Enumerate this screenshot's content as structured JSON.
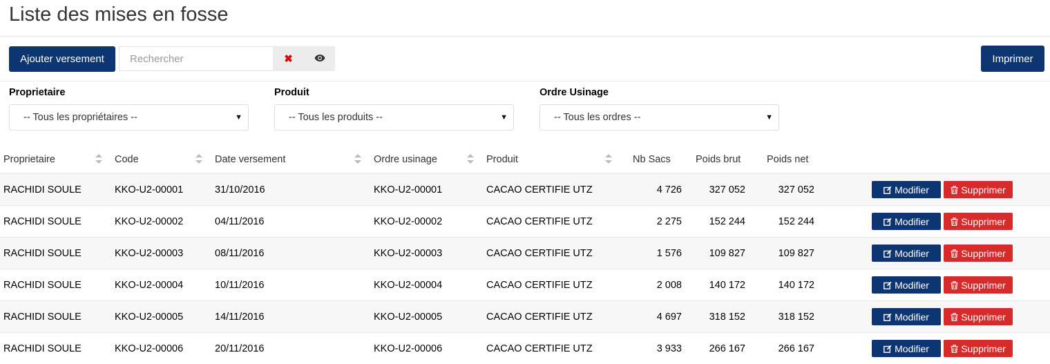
{
  "page": {
    "title": "Liste des mises en fosse"
  },
  "toolbar": {
    "add_label": "Ajouter versement",
    "search_placeholder": "Rechercher",
    "print_label": "Imprimer"
  },
  "filters": {
    "owner": {
      "label": "Proprietaire",
      "selected": "-- Tous les propriétaires --"
    },
    "product": {
      "label": "Produit",
      "selected": "-- Tous les produits --"
    },
    "order": {
      "label": "Ordre Usinage",
      "selected": "-- Tous les ordres --"
    }
  },
  "table": {
    "columns": [
      "Proprietaire",
      "Code",
      "Date versement",
      "Ordre usinage",
      "Produit",
      "Nb Sacs",
      "Poids brut",
      "Poids net"
    ],
    "edit_label": "Modifier",
    "delete_label": "Supprimer",
    "rows": [
      {
        "owner": "RACHIDI SOULE",
        "code": "KKO-U2-00001",
        "date": "31/10/2016",
        "order": "KKO-U2-00001",
        "product": "CACAO CERTIFIE UTZ",
        "bags": "4 726",
        "gross": "327 052",
        "net": "327 052"
      },
      {
        "owner": "RACHIDI SOULE",
        "code": "KKO-U2-00002",
        "date": "04/11/2016",
        "order": "KKO-U2-00002",
        "product": "CACAO CERTIFIE UTZ",
        "bags": "2 275",
        "gross": "152 244",
        "net": "152 244"
      },
      {
        "owner": "RACHIDI SOULE",
        "code": "KKO-U2-00003",
        "date": "08/11/2016",
        "order": "KKO-U2-00003",
        "product": "CACAO CERTIFIE UTZ",
        "bags": "1 576",
        "gross": "109 827",
        "net": "109 827"
      },
      {
        "owner": "RACHIDI SOULE",
        "code": "KKO-U2-00004",
        "date": "10/11/2016",
        "order": "KKO-U2-00004",
        "product": "CACAO CERTIFIE UTZ",
        "bags": "2 008",
        "gross": "140 172",
        "net": "140 172"
      },
      {
        "owner": "RACHIDI SOULE",
        "code": "KKO-U2-00005",
        "date": "14/11/2016",
        "order": "KKO-U2-00005",
        "product": "CACAO CERTIFIE UTZ",
        "bags": "4 697",
        "gross": "318 152",
        "net": "318 152"
      },
      {
        "owner": "RACHIDI SOULE",
        "code": "KKO-U2-00006",
        "date": "20/11/2016",
        "order": "KKO-U2-00006",
        "product": "CACAO CERTIFIE UTZ",
        "bags": "3 933",
        "gross": "266 167",
        "net": "266 167"
      }
    ]
  },
  "colors": {
    "primary": "#0d3572",
    "danger": "#d72a2a",
    "clear_icon": "#e00000"
  },
  "icons": {
    "clear": "x-icon",
    "view": "eye-icon",
    "edit": "edit-icon",
    "delete": "trash-icon",
    "sort": "sort-icon",
    "dropdown": "caret-down-icon"
  }
}
